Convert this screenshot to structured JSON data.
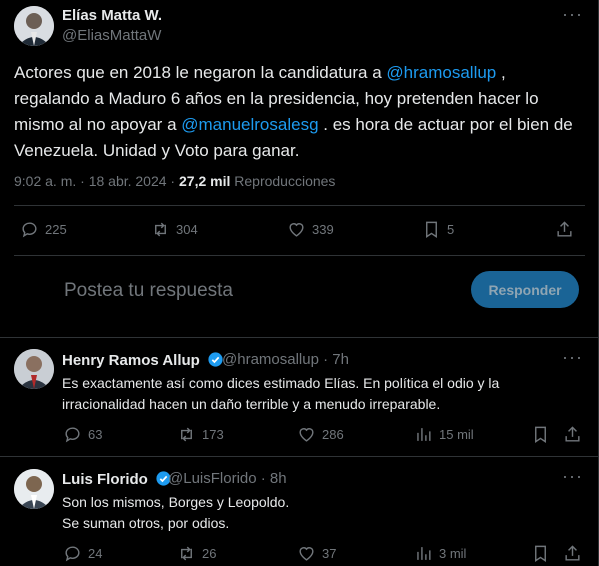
{
  "main_tweet": {
    "author_name": "Elías Matta W.",
    "author_handle": "@EliasMattaW",
    "text_1": "Actores que en 2018 le negaron la candidatura a ",
    "mention_1": "@hramosallup",
    "text_2": " , regalando a Maduro 6 años en la presidencia, hoy pretenden hacer lo mismo al no apoyar a ",
    "mention_2": "@manuelrosalesg",
    "text_3": " . es hora de actuar por el bien de Venezuela. Unidad y Voto para ganar.",
    "time": "9:02 a. m. · 18 abr. 2024 · ",
    "views_count": "27,2 mil",
    "views_label": " Reproducciones",
    "stats": {
      "replies": "225",
      "reposts": "304",
      "likes": "339",
      "bookmarks": "5"
    }
  },
  "reply_box": {
    "placeholder": "Postea tu respuesta",
    "button_label": "Responder"
  },
  "replies": [
    {
      "name": "Henry Ramos Allup",
      "handle": "@hramosallup · 7h",
      "text_line1": "Es exactamente así como dices estimado Elías. En política el odio y la",
      "text_line2": "irracionalidad hacen un daño terrible y a menudo irreparable.",
      "stats": {
        "replies": "63",
        "reposts": "173",
        "likes": "286",
        "views": "15 mil"
      }
    },
    {
      "name": "Luis Florido",
      "handle": "@LuisFlorido · 8h",
      "text_line1": "Son los mismos, Borges y Leopoldo.",
      "text_line2": "Se suman otros, por odios.",
      "stats": {
        "replies": "24",
        "reposts": "26",
        "likes": "37",
        "views": "3 mil"
      }
    }
  ],
  "icons": {
    "more": "more-horizontal-icon",
    "reply": "reply-icon",
    "repost": "repost-icon",
    "like": "like-icon",
    "bookmark": "bookmark-icon",
    "share": "share-icon",
    "views": "views-icon",
    "verified": "verified-badge-icon"
  },
  "colors": {
    "accent": "#1d9bf0",
    "muted": "#71767b",
    "background": "#000000",
    "text": "#e7e9ea"
  }
}
